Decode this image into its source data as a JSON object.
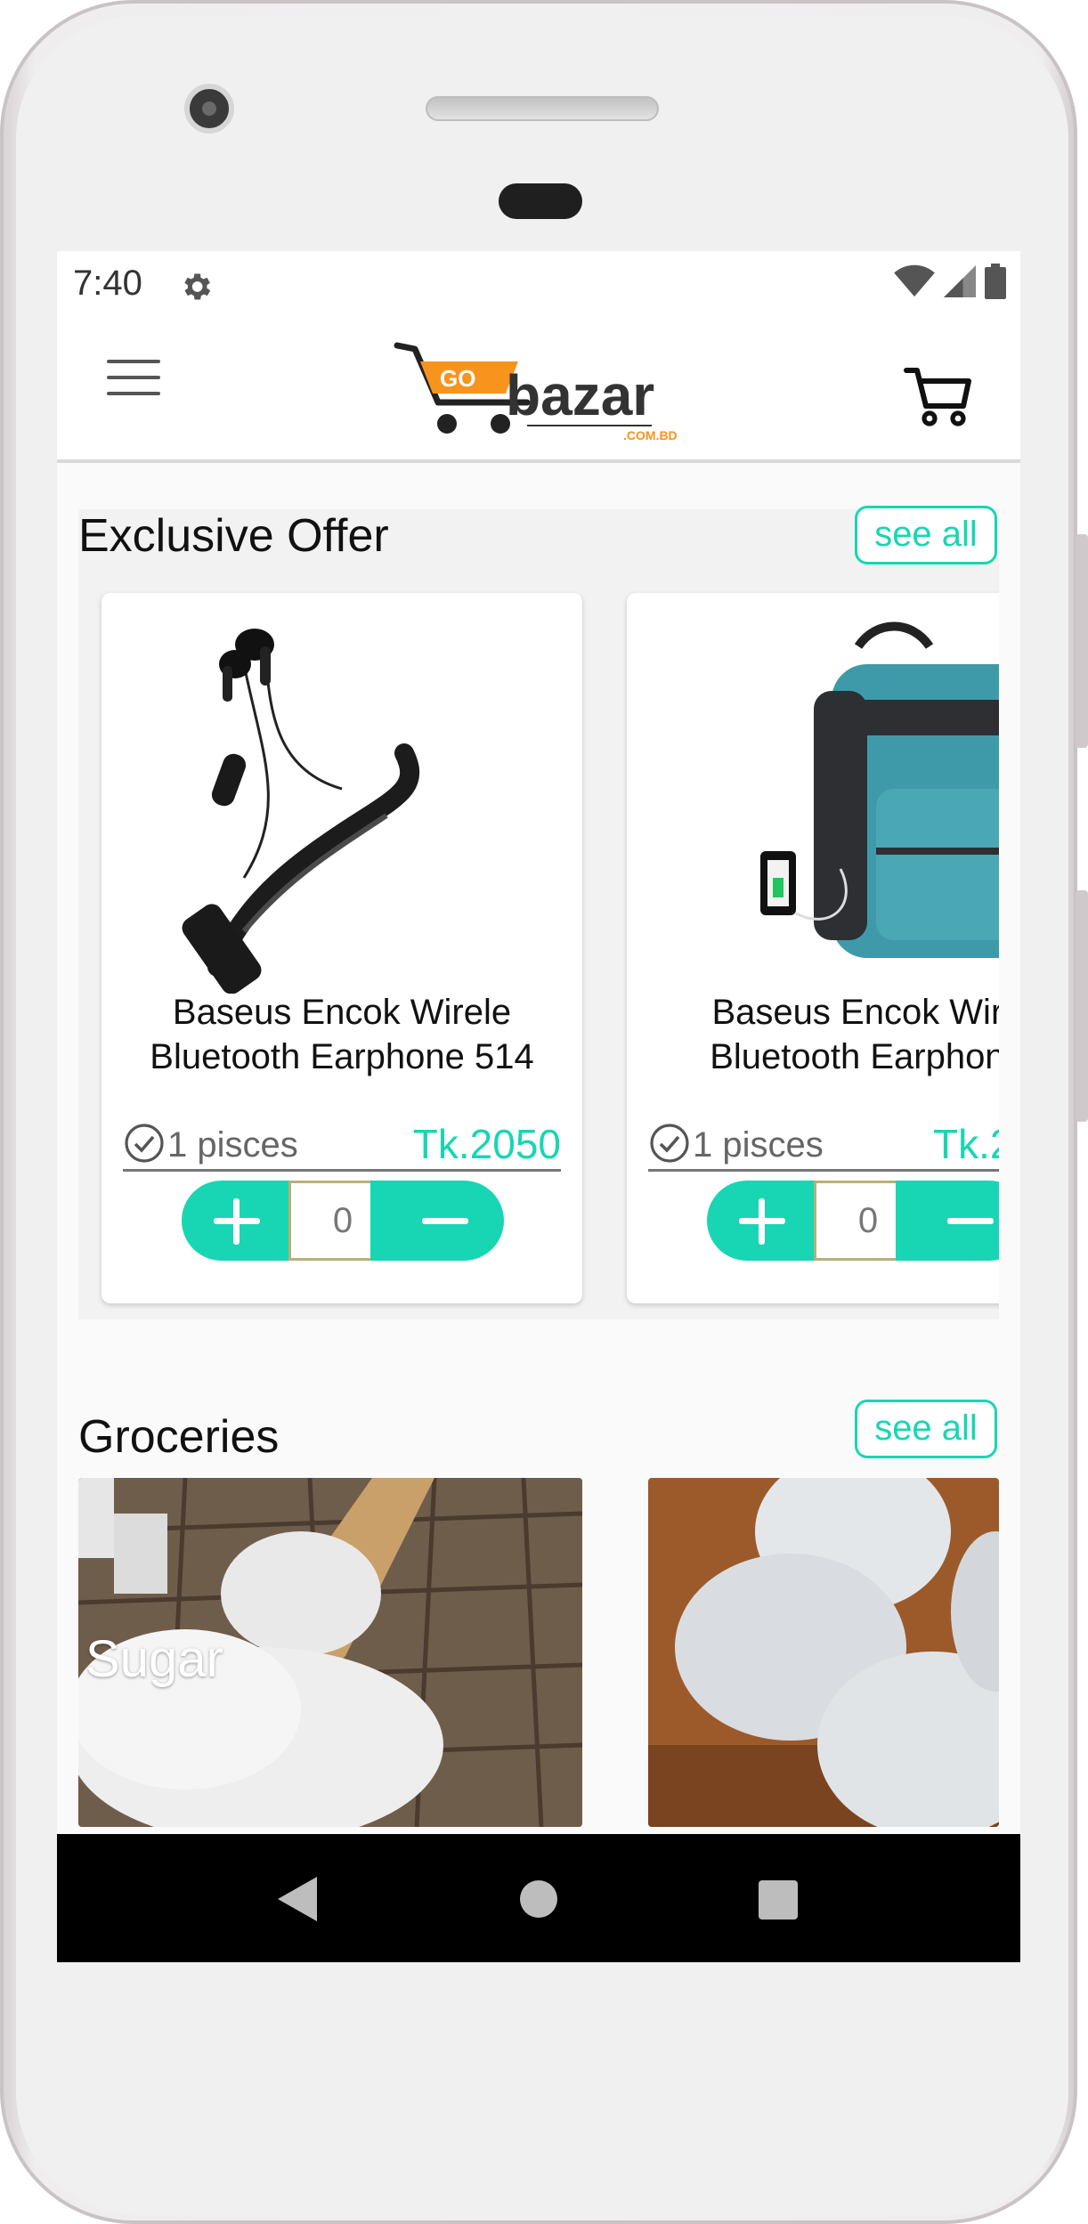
{
  "status_bar": {
    "time": "7:40",
    "icons": [
      "gear-icon",
      "wifi-icon",
      "signal-icon",
      "battery-icon"
    ]
  },
  "app_bar": {
    "logo_text": "bazar",
    "logo_badge": "GO",
    "logo_domain": ".COM.BD",
    "icons": [
      "menu-icon",
      "cart-icon"
    ]
  },
  "exclusive_offer": {
    "title": "Exclusive Offer",
    "see_all": "see all",
    "products": [
      {
        "name_line1": "Baseus Encok Wirele",
        "name_line2": "Bluetooth Earphone 514",
        "stock": "1 pisces",
        "price": "Tk.2050",
        "qty": "0",
        "image": "neckband-earphone"
      },
      {
        "name_line1": "Baseus Encok Wire",
        "name_line2": "Bluetooth Earphone",
        "stock": "1 pisces",
        "price": "Tk.2",
        "qty": "0",
        "image": "backpack"
      }
    ]
  },
  "groceries": {
    "title": "Groceries",
    "see_all": "see all",
    "items": [
      {
        "label": "Sugar",
        "image": "sugar-scoop"
      },
      {
        "label": "",
        "image": "eggs"
      }
    ]
  },
  "colors": {
    "accent": "#18d6b4",
    "logo_orange": "#f7941d",
    "nav_bar": "#000000"
  }
}
